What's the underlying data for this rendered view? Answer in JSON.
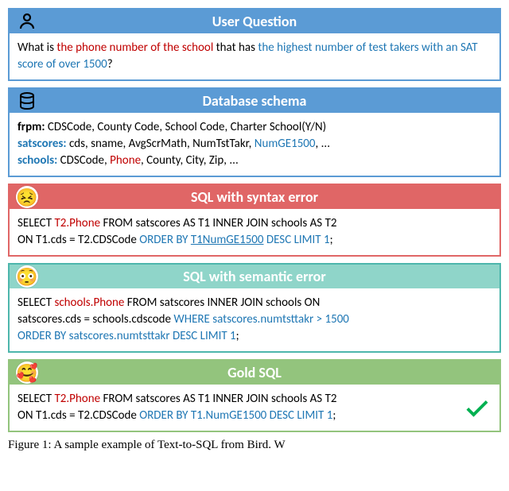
{
  "blocks": {
    "question": {
      "header": "User Question",
      "p1": "What is ",
      "p2": "the phone number of the school ",
      "p3": "that has ",
      "p4": "the highest number of test takers with an SAT score of over 1500",
      "p5": "?"
    },
    "schema": {
      "header": "Database schema",
      "l1a": "frpm: ",
      "l1b": "CDSCode, County Code, School Code, Charter School(Y/N)",
      "l2a": "satscores: ",
      "l2b": "cds, sname, AvgScrMath, NumTstTakr, ",
      "l2c": "NumGE1500",
      "l2d": ", ...",
      "l3a": "schools: ",
      "l3b": "CDSCode, ",
      "l3c": "Phone",
      "l3d": ", County, City, Zip, ..."
    },
    "syntax": {
      "header": "SQL with syntax error",
      "l1a": "SELECT ",
      "l1b": "T2.Phone ",
      "l1c": "FROM satscores AS T1 INNER JOIN schools AS T2",
      "l2a": "ON T1.cds = T2.CDSCode ",
      "l2b": "ORDER BY ",
      "l2c": "T1NumGE1500",
      "l2d": " DESC LIMIT 1",
      "l2e": ";"
    },
    "semantic": {
      "header": "SQL with semantic error",
      "l1a": "SELECT ",
      "l1b": "schools.Phone ",
      "l1c": "FROM satscores INNER JOIN schools ON",
      "l2a": "satscores.cds = schools.cdscode ",
      "l2b": "WHERE satscores.numtsttakr > 1500",
      "l3a": "ORDER BY satscores.numtsttakr DESC LIMIT 1",
      "l3b": ";"
    },
    "gold": {
      "header": "Gold SQL",
      "l1a": "SELECT ",
      "l1b": "T2.Phone ",
      "l1c": "FROM satscores AS T1 INNER JOIN schools AS T2",
      "l2a": "ON T1.cds = T2.CDSCode ",
      "l2b": "ORDER BY T1.NumGE1500 DESC LIMIT 1",
      "l2c": ";"
    }
  },
  "caption": "Figure 1: A sample example of Text-to-SQL from Bird. W"
}
